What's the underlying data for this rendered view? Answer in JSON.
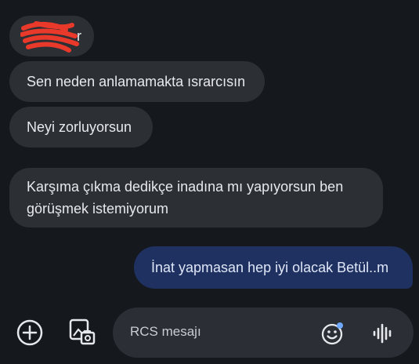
{
  "messages": {
    "received": [
      {
        "text": "r"
      },
      {
        "text": "Sen neden anlamamakta ısrarcısın"
      },
      {
        "text": "Neyi zorluyorsun"
      },
      {
        "line1": "Karşıma çıkma dedikçe inadına mı yapıyorsun ben",
        "line2": "görüşmek istemiyorum"
      }
    ],
    "sent": {
      "text": "İnat yapmasan hep iyi olacak Betül..m"
    }
  },
  "composer": {
    "placeholder": "RCS mesajı",
    "icons": [
      "add-circle-icon",
      "gallery-icon",
      "emoji-icon",
      "voice-icon"
    ]
  },
  "colors": {
    "background": "#15181d",
    "received_bubble": "#2c2f34",
    "sent_bubble": "#1f3161",
    "redaction": "#e8392b"
  }
}
